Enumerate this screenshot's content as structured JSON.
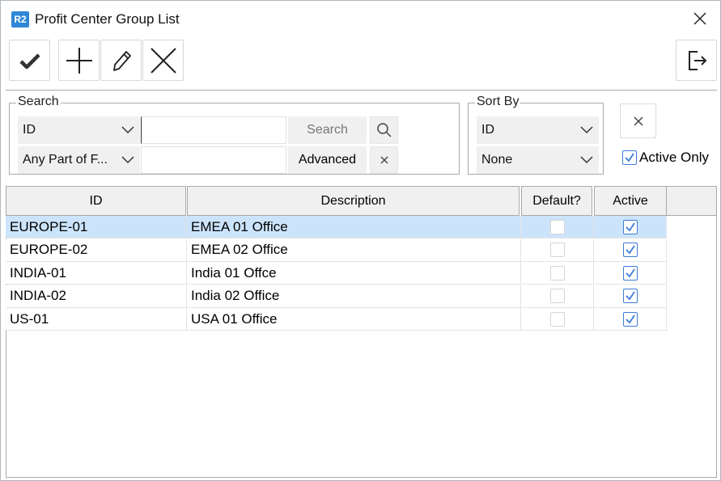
{
  "window": {
    "logo": "R2",
    "title": "Profit Center Group List"
  },
  "toolbar": {
    "buttons": [
      "check-icon",
      "plus-icon",
      "pencil-icon",
      "cross-icon"
    ],
    "exit": "exit-icon"
  },
  "search": {
    "group_label": "Search",
    "field_select": "ID",
    "match_select": "Any Part of F...",
    "search_value": "",
    "search_value2": "",
    "search_button": "Search",
    "advanced_button": "Advanced"
  },
  "sort": {
    "group_label": "Sort By",
    "primary": "ID",
    "secondary": "None"
  },
  "filter": {
    "active_only_label": "Active Only",
    "active_only_checked": true
  },
  "grid": {
    "columns": [
      "ID",
      "Description",
      "Default?",
      "Active"
    ],
    "rows": [
      {
        "id": "EUROPE-01",
        "description": "EMEA 01 Office",
        "default": false,
        "active": true
      },
      {
        "id": "EUROPE-02",
        "description": "EMEA 02 Office",
        "default": false,
        "active": true
      },
      {
        "id": "INDIA-01",
        "description": "India 01 Offce",
        "default": false,
        "active": true
      },
      {
        "id": "INDIA-02",
        "description": "India 02 Office",
        "default": false,
        "active": true
      },
      {
        "id": "US-01",
        "description": "USA 01 Office",
        "default": false,
        "active": true
      }
    ],
    "selected_row": 0
  },
  "colors": {
    "accent": "#2f86d6",
    "selection": "#cce4fb",
    "checkbox": "#3d7bd8"
  }
}
